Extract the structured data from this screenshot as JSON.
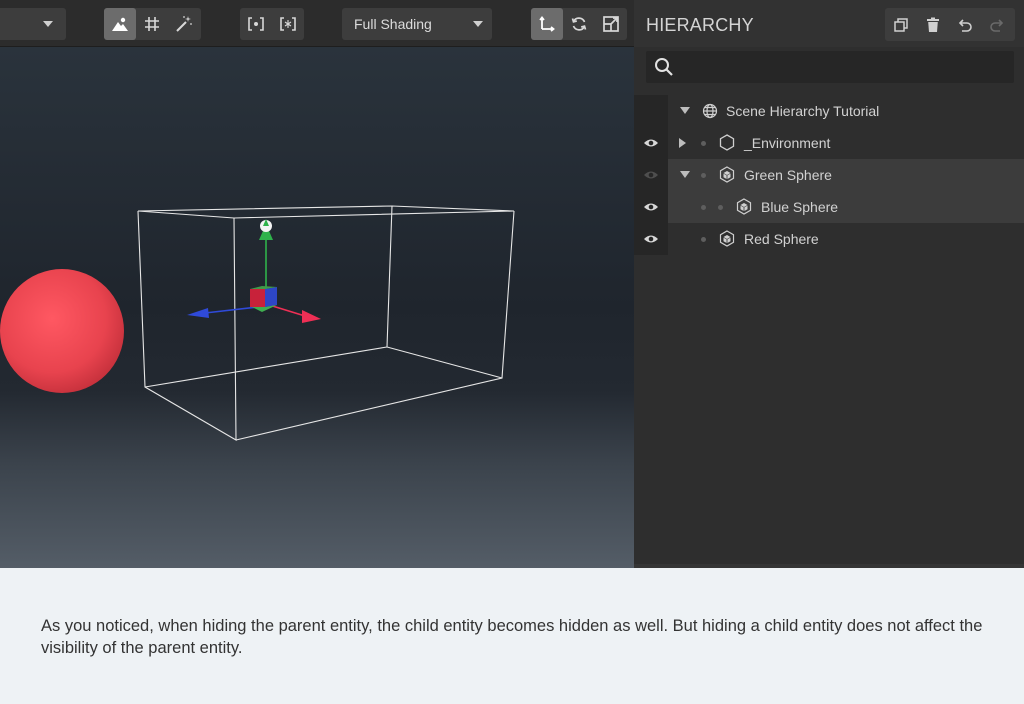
{
  "toolbar": {
    "left_dropdown": {
      "value": ""
    },
    "view_tools": [
      "landscape-icon",
      "grid-icon",
      "magic-wand-icon"
    ],
    "snap_tools": [
      "bracket-dot-icon",
      "bracket-sparkle-icon"
    ],
    "shading_dropdown": {
      "value": "Full Shading"
    },
    "transform_tools": [
      "move-icon",
      "rotate-icon",
      "scale-icon"
    ]
  },
  "hierarchy": {
    "title": "HIERARCHY",
    "actions": [
      "duplicate-icon",
      "trash-icon",
      "undo-icon",
      "redo-icon"
    ],
    "search": {
      "value": "",
      "placeholder": ""
    },
    "items": [
      {
        "label": "Scene Hierarchy Tutorial",
        "icon": "globe-icon",
        "expanded": true,
        "visible": true
      },
      {
        "label": "_Environment",
        "icon": "hexagon-icon",
        "expanded": false,
        "visible": true
      },
      {
        "label": "Green Sphere",
        "icon": "cube-icon",
        "expanded": true,
        "visible": false,
        "selected": true
      },
      {
        "label": "Blue Sphere",
        "icon": "cube-icon",
        "visible": true,
        "selected": true
      },
      {
        "label": "Red Sphere",
        "icon": "cube-icon",
        "visible": true
      }
    ]
  },
  "caption": "As you noticed, when hiding the parent entity, the child entity becomes hidden as well. But hiding a child entity does not affect the visibility of the parent entity.",
  "colors": {
    "red_sphere": "#e8434e",
    "gizmo_y": "#2fb24b",
    "gizmo_x": "#ef2f55",
    "gizmo_z": "#2f4ad9",
    "panel_bg": "#2e2e2e"
  }
}
